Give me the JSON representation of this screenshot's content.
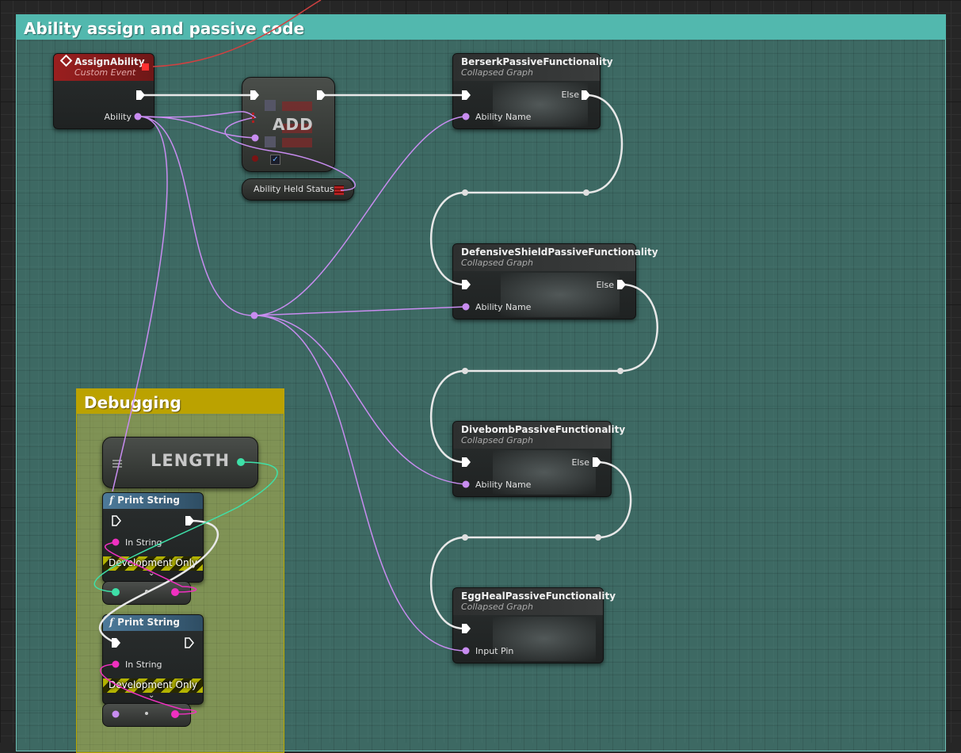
{
  "comments": {
    "main": {
      "title": "Ability assign and passive code",
      "color": "#52b8ae"
    },
    "debug": {
      "title": "Debugging",
      "color": "#bba200"
    }
  },
  "nodes": {
    "assign_ability": {
      "title": "AssignAbility",
      "subtitle": "Custom Event",
      "pin_ability": "Ability"
    },
    "add": {
      "label": "ADD"
    },
    "ability_held_status": {
      "label": "Ability Held Status"
    },
    "berserk": {
      "title": "BerserkPassiveFunctionality",
      "subtitle": "Collapsed Graph",
      "pin_else": "Else",
      "pin_input": "Ability Name"
    },
    "defensive": {
      "title": "DefensiveShieldPassiveFunctionality",
      "subtitle": "Collapsed Graph",
      "pin_else": "Else",
      "pin_input": "Ability Name"
    },
    "divebomb": {
      "title": "DivebombPassiveFunctionality",
      "subtitle": "Collapsed Graph",
      "pin_else": "Else",
      "pin_input": "Ability Name"
    },
    "egg_heal": {
      "title": "EggHealPassiveFunctionality",
      "subtitle": "Collapsed Graph",
      "pin_input": "Input Pin"
    },
    "length": {
      "label": "LENGTH"
    },
    "print_string_1": {
      "title": "Print String",
      "pin_in": "In String",
      "dev_only": "Development Only"
    },
    "print_string_2": {
      "title": "Print String",
      "pin_in": "In String",
      "dev_only": "Development Only"
    }
  },
  "icons": {
    "event": "event-diamond-icon",
    "function": "function-f-icon",
    "array": "array-grid-icon",
    "exec": "exec-pin-icon"
  },
  "colors": {
    "exec_wire": "#e8e8e8",
    "name_wire": "#c88cf0",
    "int_wire": "#3ee0a8",
    "string_wire": "#f030c0",
    "event_wire": "#d04040"
  }
}
